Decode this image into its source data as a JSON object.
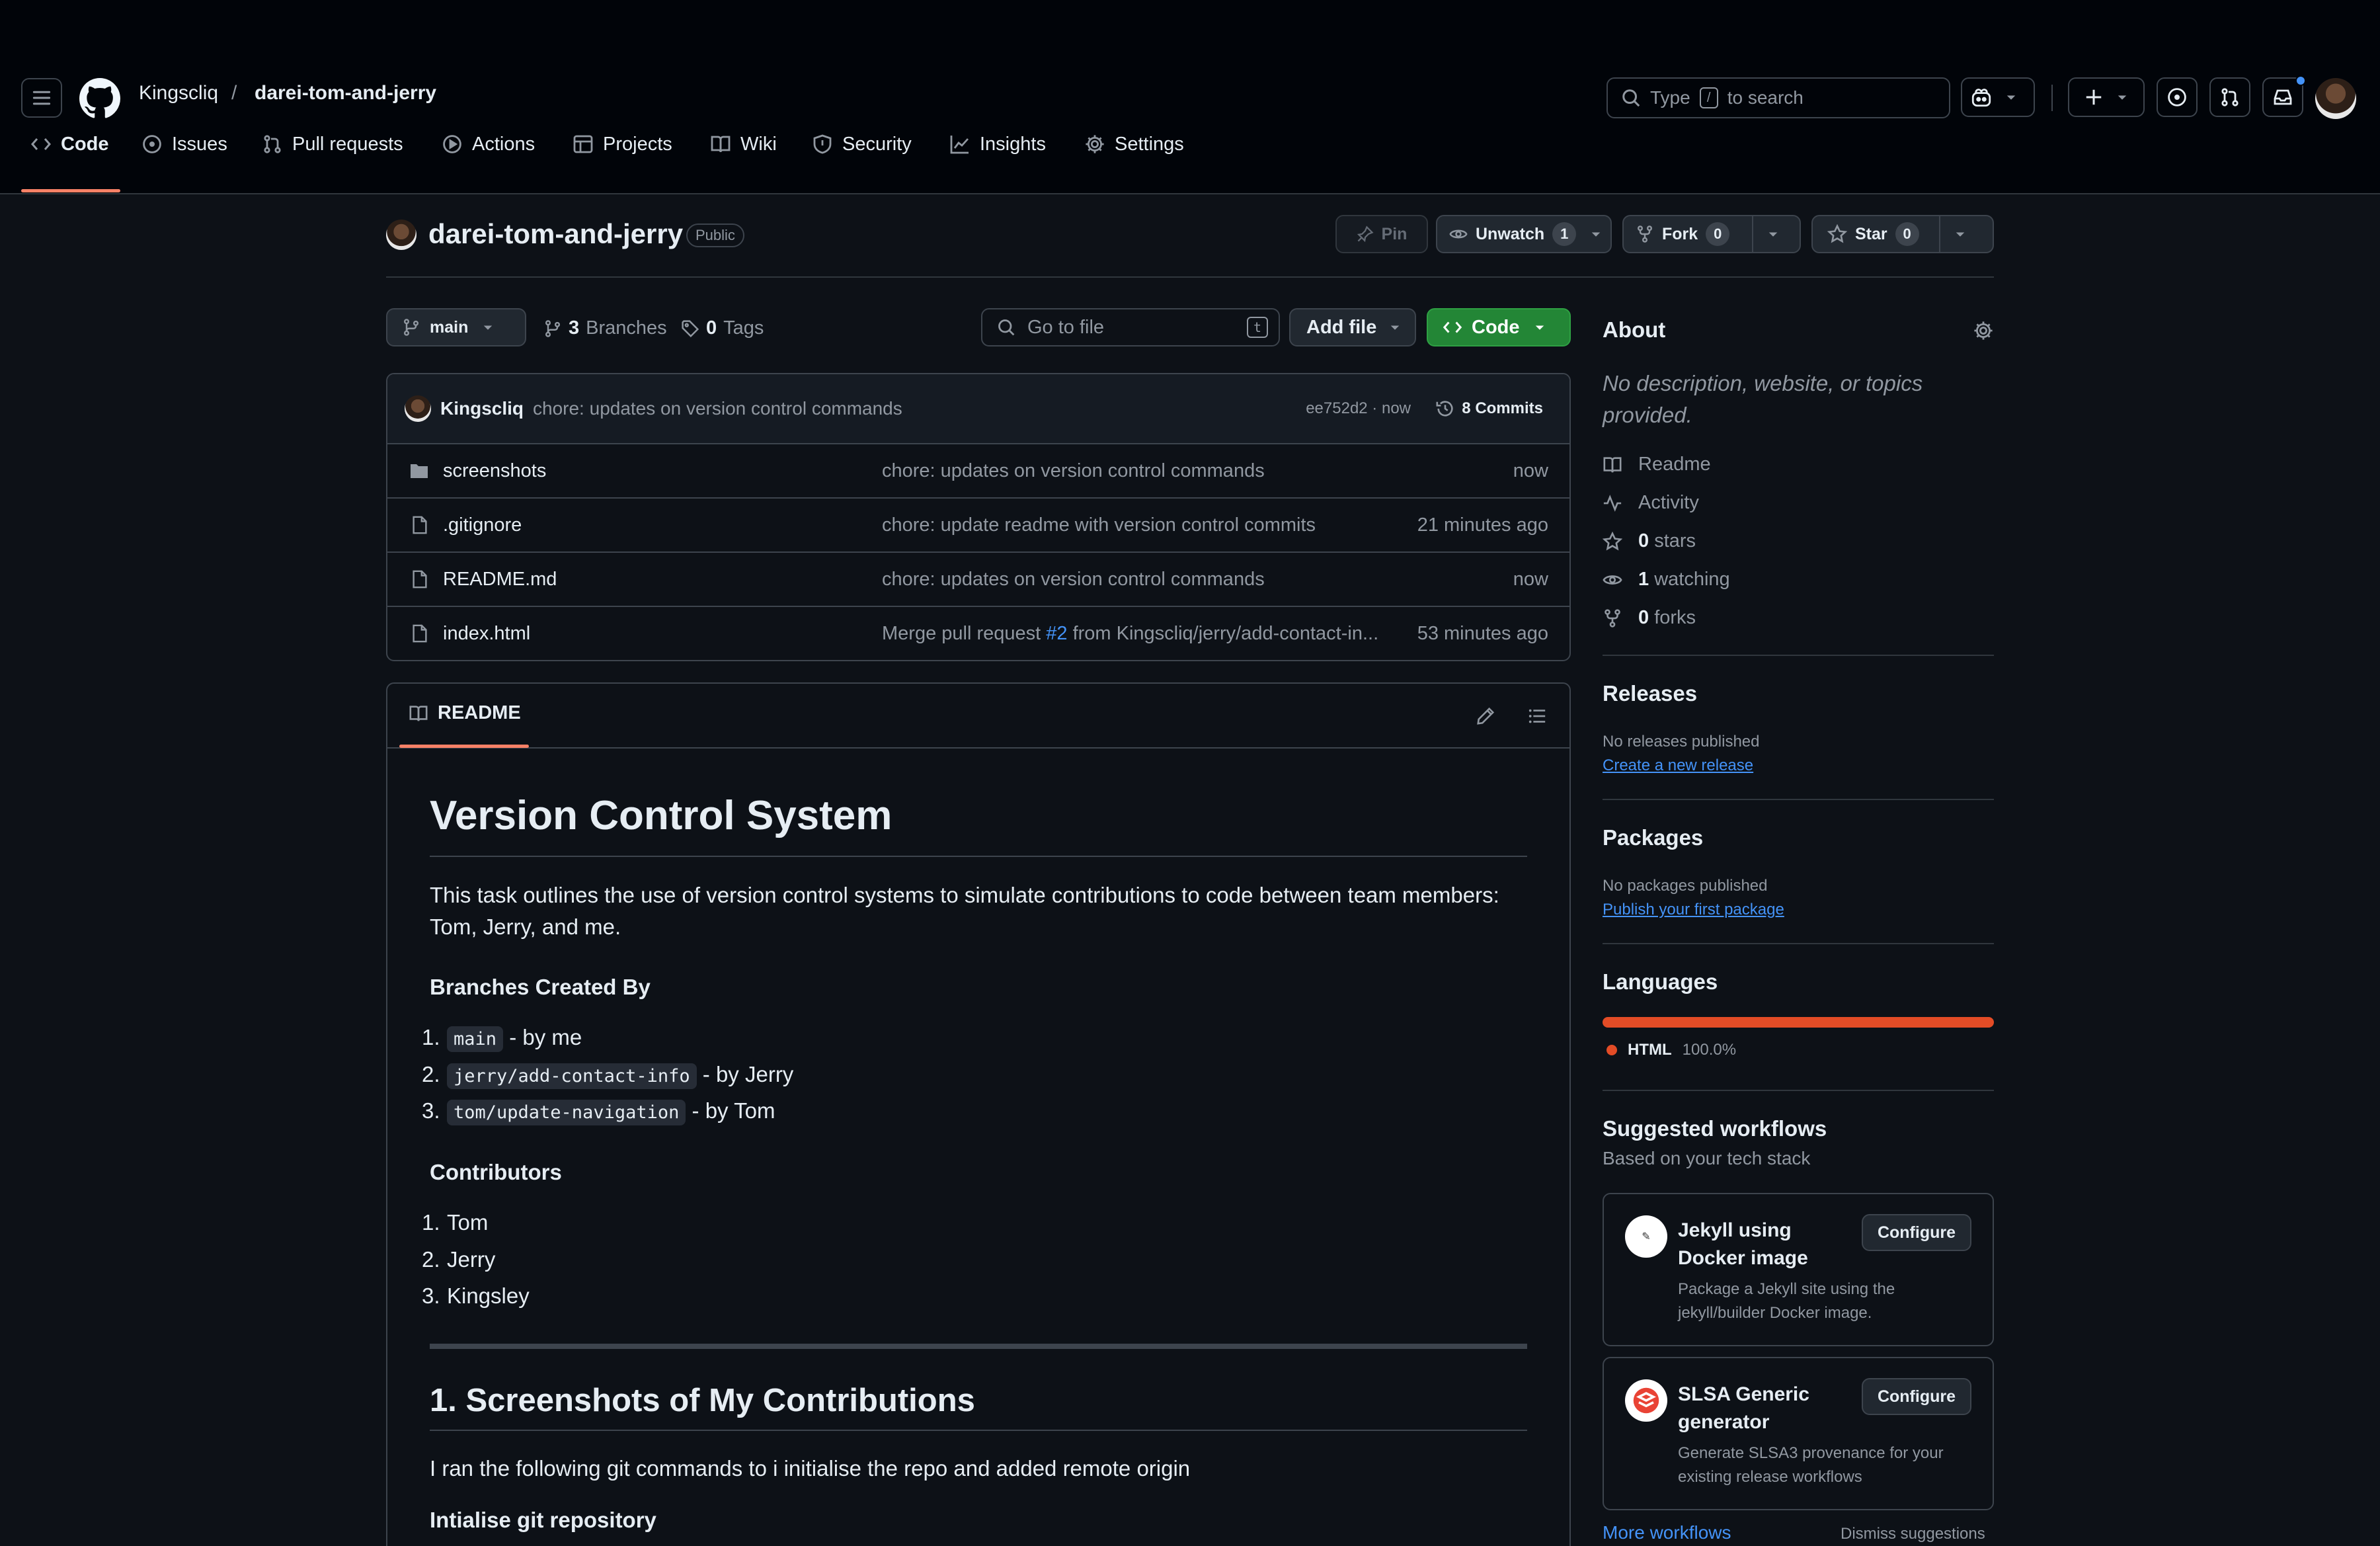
{
  "header": {
    "owner": "Kingscliq",
    "separator": "/",
    "repo": "darei-tom-and-jerry",
    "search_prefix": "Type",
    "search_key": "/",
    "search_suffix": "to search"
  },
  "nav": {
    "tabs": [
      {
        "label": "Code"
      },
      {
        "label": "Issues"
      },
      {
        "label": "Pull requests"
      },
      {
        "label": "Actions"
      },
      {
        "label": "Projects"
      },
      {
        "label": "Wiki"
      },
      {
        "label": "Security"
      },
      {
        "label": "Insights"
      },
      {
        "label": "Settings"
      }
    ]
  },
  "repo": {
    "name": "darei-tom-and-jerry",
    "visibility": "Public",
    "pin_label": "Pin",
    "unwatch_label": "Unwatch",
    "watch_count": "1",
    "fork_label": "Fork",
    "fork_count": "0",
    "star_label": "Star",
    "star_count": "0"
  },
  "toolbar": {
    "branch": "main",
    "branches_count": "3",
    "branches_label": "Branches",
    "tags_count": "0",
    "tags_label": "Tags",
    "go_to_file": "Go to file",
    "go_to_file_key": "t",
    "add_file": "Add file",
    "code_button": "Code"
  },
  "latest_commit": {
    "author": "Kingscliq",
    "message": "chore: updates on version control commands",
    "hash_time": "ee752d2 · now",
    "commits_label": "8 Commits"
  },
  "files": [
    {
      "name": "screenshots",
      "type": "folder",
      "message": "chore: updates on version control commands",
      "time": "now"
    },
    {
      "name": ".gitignore",
      "type": "file",
      "message": "chore: update readme with version control commits",
      "time": "21 minutes ago"
    },
    {
      "name": "README.md",
      "type": "file",
      "message": "chore: updates on version control commands",
      "time": "now"
    },
    {
      "name": "index.html",
      "type": "file",
      "message_prefix": "Merge pull request ",
      "message_link": "#2",
      "message_suffix": " from Kingscliq/jerry/add-contact-in...",
      "time": "53 minutes ago"
    }
  ],
  "readme": {
    "tab_label": "README",
    "title": "Version Control System",
    "intro": "This task outlines the use of version control systems to simulate contributions to code between team members: Tom, Jerry, and me.",
    "branches_heading": "Branches Created By",
    "branches": [
      {
        "num": "1.",
        "code": "main",
        "text": "- by me"
      },
      {
        "num": "2.",
        "code": "jerry/add-contact-info",
        "text": "- by Jerry"
      },
      {
        "num": "3.",
        "code": "tom/update-navigation",
        "text": "- by Tom"
      }
    ],
    "contributors_heading": "Contributors",
    "contributors": [
      {
        "num": "1.",
        "name": "Tom"
      },
      {
        "num": "2.",
        "name": "Jerry"
      },
      {
        "num": "3.",
        "name": "Kingsley"
      }
    ],
    "section_heading": "1. Screenshots of My Contributions",
    "section_text": "I ran the following git commands to i initialise the repo and added remote origin",
    "subheading": "Intialise git repository"
  },
  "about": {
    "heading": "About",
    "description": "No description, website, or topics provided.",
    "readme": "Readme",
    "activity": "Activity",
    "stars_count": "0",
    "stars_label": "stars",
    "watching_count": "1",
    "watching_label": "watching",
    "forks_count": "0",
    "forks_label": "forks"
  },
  "releases": {
    "heading": "Releases",
    "none": "No releases published",
    "link": "Create a new release"
  },
  "packages": {
    "heading": "Packages",
    "none": "No packages published",
    "link": "Publish your first package"
  },
  "languages": {
    "heading": "Languages",
    "items": [
      {
        "name": "HTML",
        "percent": "100.0%",
        "fraction": 1.0,
        "color": "#e34c26"
      }
    ]
  },
  "workflows": {
    "heading": "Suggested workflows",
    "subheading": "Based on your tech stack",
    "items": [
      {
        "title": "Jekyll using Docker image",
        "description": "Package a Jekyll site using the jekyll/builder Docker image.",
        "button": "Configure"
      },
      {
        "title": "SLSA Generic generator",
        "description": "Generate SLSA3 provenance for your existing release workflows",
        "button": "Configure"
      }
    ],
    "more_link": "More workflows",
    "dismiss_link": "Dismiss suggestions"
  },
  "colors": {
    "accent_green": "#238636",
    "tab_underline": "#f78166",
    "link_blue": "#4493f8",
    "notification_dot": "#4493f8"
  }
}
